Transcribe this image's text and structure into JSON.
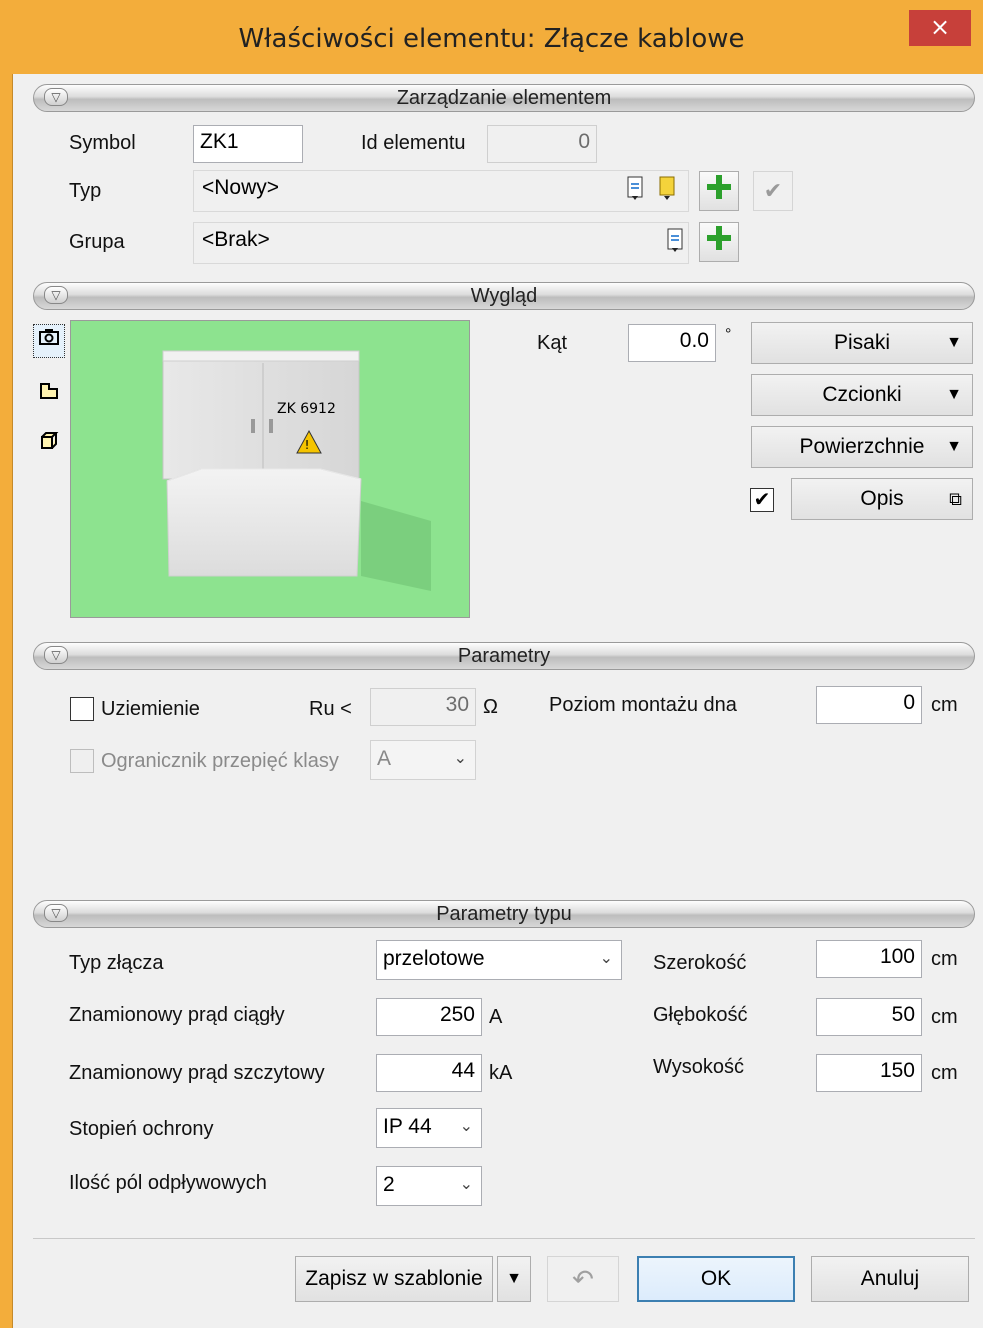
{
  "window": {
    "title": "Właściwości elementu: Złącze kablowe",
    "close_glyph": "×"
  },
  "sections": {
    "management": "Zarządzanie elementem",
    "appearance": "Wygląd",
    "parameters": "Parametry",
    "type_parameters": "Parametry typu"
  },
  "management": {
    "symbol_label": "Symbol",
    "symbol_value": "ZK1",
    "id_label": "Id elementu",
    "id_value": "0",
    "type_label": "Typ",
    "type_value": "<Nowy>",
    "group_label": "Grupa",
    "group_value": "<Brak>"
  },
  "appearance": {
    "angle_label": "Kąt",
    "angle_value": "0.0",
    "angle_unit": "°",
    "pens_label": "Pisaki",
    "fonts_label": "Czcionki",
    "surfaces_label": "Powierzchnie",
    "description_label": "Opis",
    "description_checked": true,
    "preview_label": "ZK 6912"
  },
  "parameters": {
    "grounding_label": "Uziemienie",
    "grounding_checked": false,
    "ru_label": "Ru <",
    "ru_value": "30",
    "ru_unit": "Ω",
    "mount_label": "Poziom montażu dna",
    "mount_value": "0",
    "mount_unit": "cm",
    "surge_label": "Ogranicznik przepięć klasy",
    "surge_value": "A"
  },
  "type_params": {
    "connector_type_label": "Typ złącza",
    "connector_type_value": "przelotowe",
    "rated_current_label": "Znamionowy prąd ciągły",
    "rated_current_value": "250",
    "rated_current_unit": "A",
    "peak_current_label": "Znamionowy prąd szczytowy",
    "peak_current_value": "44",
    "peak_current_unit": "kA",
    "protection_label": "Stopień ochrony",
    "protection_value": "IP 44",
    "outlets_label": "Ilość pól odpływowych",
    "outlets_value": "2",
    "width_label": "Szerokość",
    "width_value": "100",
    "depth_label": "Głębokość",
    "depth_value": "50",
    "height_label": "Wysokość",
    "height_value": "150",
    "unit_cm": "cm"
  },
  "footer": {
    "save_template": "Zapisz w szablonie",
    "ok": "OK",
    "cancel": "Anuluj"
  },
  "icons": {
    "arrow_down": "▼",
    "chevron_down": "⌄",
    "check": "✔",
    "plus": "+",
    "undo": "↶"
  },
  "colors": {
    "title_bar": "#f3ad3b",
    "close": "#c7403a",
    "preview_bg": "#8de38f",
    "plus_green": "#2ca02c"
  }
}
